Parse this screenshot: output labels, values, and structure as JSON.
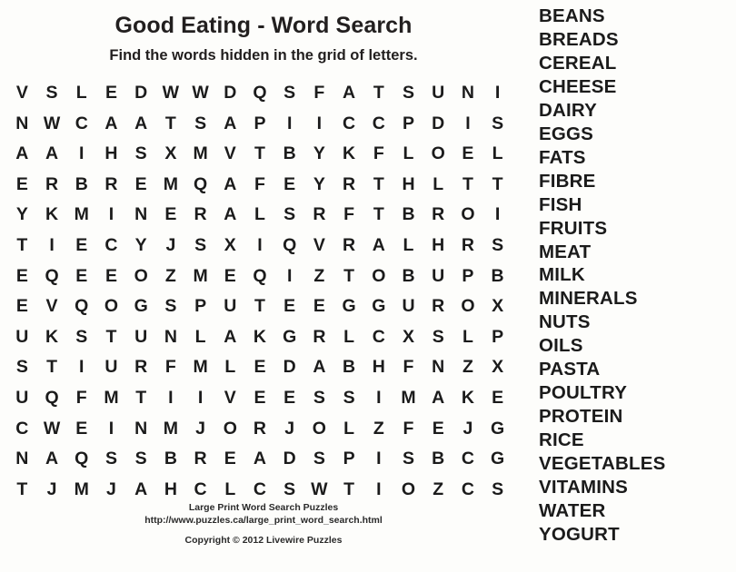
{
  "document": {
    "title": "Good Eating - Word Search",
    "subtitle": "Find the words hidden in the grid of letters.",
    "text_color": "#1b1b1b",
    "background_color": "#fdfdfb"
  },
  "grid": {
    "columns": 17,
    "rows_count": 14,
    "rows": [
      [
        "V",
        "S",
        "L",
        "E",
        "D",
        "W",
        "W",
        "D",
        "Q",
        "S",
        "F",
        "A",
        "T",
        "S",
        "U",
        "N",
        "I"
      ],
      [
        "N",
        "W",
        "C",
        "A",
        "A",
        "T",
        "S",
        "A",
        "P",
        "I",
        "I",
        "C",
        "C",
        "P",
        "D",
        "I",
        "S"
      ],
      [
        "A",
        "A",
        "I",
        "H",
        "S",
        "X",
        "M",
        "V",
        "T",
        "B",
        "Y",
        "K",
        "F",
        "L",
        "O",
        "E",
        "L"
      ],
      [
        "E",
        "R",
        "B",
        "R",
        "E",
        "M",
        "Q",
        "A",
        "F",
        "E",
        "Y",
        "R",
        "T",
        "H",
        "L",
        "T",
        "T"
      ],
      [
        "Y",
        "K",
        "M",
        "I",
        "N",
        "E",
        "R",
        "A",
        "L",
        "S",
        "R",
        "F",
        "T",
        "B",
        "R",
        "O",
        "I"
      ],
      [
        "T",
        "I",
        "E",
        "C",
        "Y",
        "J",
        "S",
        "X",
        "I",
        "Q",
        "V",
        "R",
        "A",
        "L",
        "H",
        "R",
        "S"
      ],
      [
        "E",
        "Q",
        "E",
        "E",
        "O",
        "Z",
        "M",
        "E",
        "Q",
        "I",
        "Z",
        "T",
        "O",
        "B",
        "U",
        "P",
        "B"
      ],
      [
        "E",
        "V",
        "Q",
        "O",
        "G",
        "S",
        "P",
        "U",
        "T",
        "E",
        "E",
        "G",
        "G",
        "U",
        "R",
        "O",
        "X"
      ],
      [
        "U",
        "K",
        "S",
        "T",
        "U",
        "N",
        "L",
        "A",
        "K",
        "G",
        "R",
        "L",
        "C",
        "X",
        "S",
        "L",
        "P"
      ],
      [
        "S",
        "T",
        "I",
        "U",
        "R",
        "F",
        "M",
        "L",
        "E",
        "D",
        "A",
        "B",
        "H",
        "F",
        "N",
        "Z",
        "X"
      ],
      [
        "U",
        "Q",
        "F",
        "M",
        "T",
        "I",
        "I",
        "V",
        "E",
        "E",
        "S",
        "S",
        "I",
        "M",
        "A",
        "K",
        "E"
      ],
      [
        "C",
        "W",
        "E",
        "I",
        "N",
        "M",
        "J",
        "O",
        "R",
        "J",
        "O",
        "L",
        "Z",
        "F",
        "E",
        "J",
        "G"
      ],
      [
        "N",
        "A",
        "Q",
        "S",
        "S",
        "B",
        "R",
        "E",
        "A",
        "D",
        "S",
        "P",
        "I",
        "S",
        "B",
        "C",
        "G"
      ],
      [
        "T",
        "J",
        "M",
        "J",
        "A",
        "H",
        "C",
        "L",
        "C",
        "S",
        "W",
        "T",
        "I",
        "O",
        "Z",
        "C",
        "S"
      ]
    ]
  },
  "word_list": {
    "words": [
      "BEANS",
      "BREADS",
      "CEREAL",
      "CHEESE",
      "DAIRY",
      "EGGS",
      "FATS",
      "FIBRE",
      "FISH",
      "FRUITS",
      "MEAT",
      "MILK",
      "MINERALS",
      "NUTS",
      "OILS",
      "PASTA",
      "POULTRY",
      "PROTEIN",
      "RICE",
      "VEGETABLES",
      "VITAMINS",
      "WATER",
      "YOGURT"
    ]
  },
  "footer": {
    "publisher": "Large Print Word Search Puzzles",
    "url": "http://www.puzzles.ca/large_print_word_search.html",
    "copyright": "Copyright © 2012 Livewire Puzzles"
  }
}
